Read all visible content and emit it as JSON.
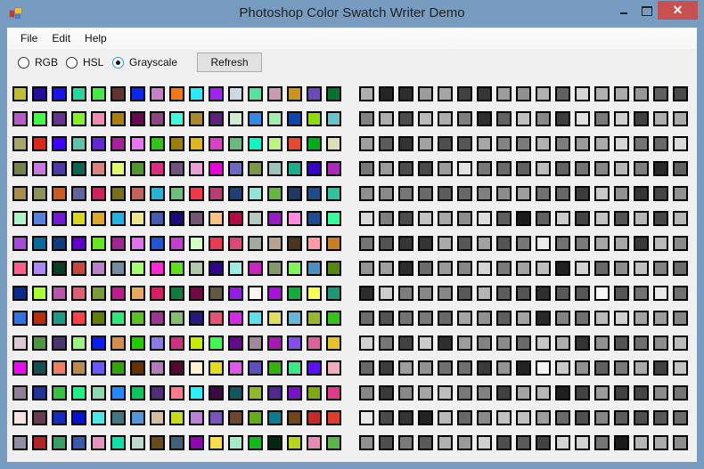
{
  "window": {
    "title": "Photoshop Color Swatch Writer Demo",
    "close_glyph": "✕"
  },
  "menu": [
    "File",
    "Edit",
    "Help"
  ],
  "modes": [
    {
      "label": "RGB",
      "selected": false
    },
    {
      "label": "HSL",
      "selected": false
    },
    {
      "label": "Grayscale",
      "selected": true
    }
  ],
  "refresh_label": "Refresh",
  "swatches": [
    [
      "#c0bd35",
      "#22109c",
      "#1814e6",
      "#29d6a0",
      "#48e846",
      "#633231",
      "#0a27ec",
      "#c482c6",
      "#f27716",
      "#2ce9f8",
      "#a024f0",
      "#cbd9e0",
      "#56e19e",
      "#c79cb0",
      "#c8961f",
      "#6a4ab7",
      "#0a702e"
    ],
    [
      "#b55bc3",
      "#41f946",
      "#67318d",
      "#86f127",
      "#ef8ab4",
      "#a88011",
      "#660a50",
      "#8c4682",
      "#41fbe0",
      "#ab8730",
      "#5e217b",
      "#d0ecd0",
      "#3388e1",
      "#9feeb0",
      "#0f47a9",
      "#8edb0e",
      "#6ac3c6"
    ],
    [
      "#a6a66b",
      "#da2818",
      "#3e04fb",
      "#5dc3aa",
      "#6328cf",
      "#a71f9b",
      "#e677f1",
      "#32c21c",
      "#9e7e04",
      "#deb620",
      "#d841c3",
      "#6ab97f",
      "#11f5c4",
      "#bdf385",
      "#e24a33",
      "#04ac1c",
      "#dedfb8"
    ],
    [
      "#71844b",
      "#cb76df",
      "#4f39a7",
      "#0e6352",
      "#db827f",
      "#e3f76e",
      "#529631",
      "#da2d7f",
      "#71517e",
      "#eb9fd6",
      "#e904d7",
      "#6c6abf",
      "#7d9845",
      "#9ec3bd",
      "#1eac90",
      "#3505c1",
      "#aa29b6"
    ],
    [
      "#a88d4c",
      "#8b9358",
      "#c95c22",
      "#61659b",
      "#d0215d",
      "#776f19",
      "#c1655c",
      "#29b2d8",
      "#6fbd7d",
      "#f03a4b",
      "#b93b73",
      "#1f4076",
      "#94e1d6",
      "#68b540",
      "#213961",
      "#1f4c89",
      "#33c09e"
    ],
    [
      "#b0f2c9",
      "#5482dc",
      "#741bd6",
      "#dbd520",
      "#daa72b",
      "#26b2e0",
      "#ede48e",
      "#435bb0",
      "#1e097a",
      "#745474",
      "#f6c285",
      "#b20b46",
      "#b5c9c1",
      "#971cc5",
      "#ff89de",
      "#1f4b93",
      "#38fc9b"
    ],
    [
      "#a64ad6",
      "#086b99",
      "#133b7c",
      "#6000cb",
      "#66e91b",
      "#9e2794",
      "#df73ea",
      "#2156cc",
      "#c240cd",
      "#d5fec6",
      "#e93a56",
      "#da4a79",
      "#a4aaa1",
      "#b8a391",
      "#48371c",
      "#fe9ba6",
      "#c77f26"
    ],
    [
      "#fb608b",
      "#ab88f2",
      "#0c3c24",
      "#c6463e",
      "#b982c6",
      "#738ba0",
      "#a7fc77",
      "#f829d0",
      "#5fde1c",
      "#aecbac",
      "#2e0883",
      "#9cede0",
      "#c626c0",
      "#85976c",
      "#82f45a",
      "#4f8fbe",
      "#558813"
    ],
    [
      "#0b2a89",
      "#a9fd33",
      "#b956ac",
      "#dc5f75",
      "#7c9c3b",
      "#bb1d8a",
      "#e6aa60",
      "#d61e62",
      "#107b3c",
      "#700847",
      "#605a42",
      "#931ee3",
      "#fcf4ef",
      "#a813db",
      "#14ac3c",
      "#f6fe57",
      "#1e9776"
    ],
    [
      "#3473df",
      "#b62e09",
      "#1e9a86",
      "#fe4047",
      "#607d05",
      "#30e67d",
      "#5ac12a",
      "#9d3590",
      "#84bd6f",
      "#261b7c",
      "#e25478",
      "#d12ce2",
      "#5ee0eb",
      "#e1dd5e",
      "#69b5d4",
      "#97b52f",
      "#34c21b"
    ],
    [
      "#dccad6",
      "#4f963e",
      "#4c3470",
      "#9af37e",
      "#0b1ced",
      "#d48f4d",
      "#22cc00",
      "#8a7ae4",
      "#cc327f",
      "#c4ec08",
      "#3ff952",
      "#630a8b",
      "#a1899c",
      "#a718b0",
      "#834de9",
      "#d8649b",
      "#e4c22a"
    ],
    [
      "#e70ded",
      "#144e52",
      "#ef7f61",
      "#bb8b4d",
      "#6b58fc",
      "#2fa40f",
      "#623104",
      "#b37bb9",
      "#530a31",
      "#fef4d4",
      "#e2dd22",
      "#dc59e6",
      "#604ebd",
      "#34b30c",
      "#3ce88a",
      "#5c11f2",
      "#f1acbd"
    ],
    [
      "#917f95",
      "#213399",
      "#38bf45",
      "#1ff285",
      "#8ed8ae",
      "#2688ff",
      "#0cc559",
      "#502d7b",
      "#fe7a8d",
      "#2cf0f9",
      "#3c0947",
      "#14565e",
      "#91b82a",
      "#52278f",
      "#7714c2",
      "#7ea816",
      "#de3a87"
    ],
    [
      "#f7e1e1",
      "#683b53",
      "#1629be",
      "#0811cd",
      "#4de8e6",
      "#427781",
      "#5397d4",
      "#d5bda4",
      "#c8dd1a",
      "#bc82d6",
      "#7a53bd",
      "#6d4830",
      "#62ad1a",
      "#0a7c92",
      "#724718",
      "#c42a28",
      "#dd3c2f"
    ],
    [
      "#928da3",
      "#b22527",
      "#3b9e64",
      "#375aab",
      "#e593bf",
      "#10dfa7",
      "#bfdacd",
      "#694a1f",
      "#406178",
      "#8d06b0",
      "#f6df48",
      "#a5ebc5",
      "#14b720",
      "#032811",
      "#b5d320",
      "#e68bb5",
      "#5ab44b"
    ]
  ]
}
